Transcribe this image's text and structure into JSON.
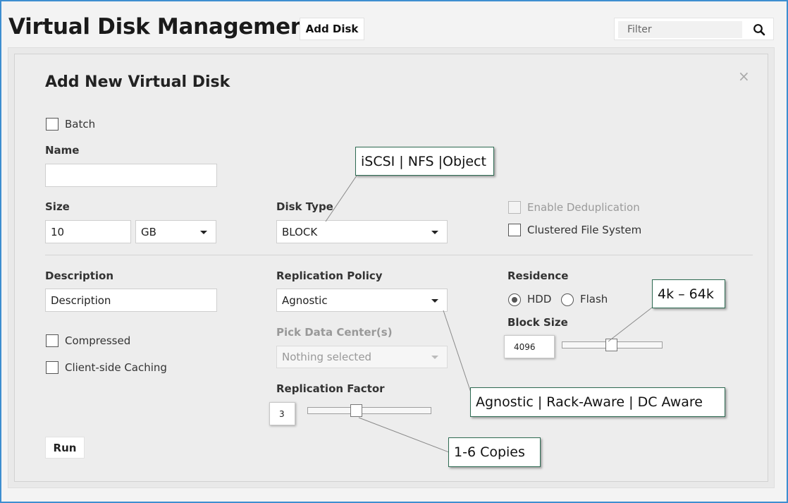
{
  "header": {
    "title": "Virtual Disk Management",
    "add_disk_label": "Add Disk",
    "filter_placeholder": "Filter",
    "search_icon": "search-icon"
  },
  "dialog": {
    "title": "Add New Virtual Disk",
    "close_label": "×",
    "batch": {
      "label": "Batch",
      "checked": false
    },
    "name": {
      "label": "Name",
      "value": ""
    },
    "size": {
      "label": "Size",
      "value": "10",
      "unit": "GB"
    },
    "disk_type": {
      "label": "Disk Type",
      "value": "BLOCK"
    },
    "enable_dedup": {
      "label": "Enable Deduplication",
      "checked": false,
      "disabled": true
    },
    "clustered_fs": {
      "label": "Clustered File System",
      "checked": false
    },
    "description": {
      "label": "Description",
      "value": "Description"
    },
    "compressed": {
      "label": "Compressed",
      "checked": false
    },
    "client_caching": {
      "label": "Client-side Caching",
      "checked": false
    },
    "replication_policy": {
      "label": "Replication Policy",
      "value": "Agnostic"
    },
    "pick_dc": {
      "label": "Pick Data Center(s)",
      "placeholder": "Nothing selected",
      "disabled": true
    },
    "replication_factor": {
      "label": "Replication Factor",
      "value": "3",
      "min": 1,
      "max": 6
    },
    "residence": {
      "label": "Residence",
      "options": [
        "HDD",
        "Flash"
      ],
      "selected": "HDD"
    },
    "block_size": {
      "label": "Block Size",
      "value": "4096"
    },
    "run_label": "Run"
  },
  "callouts": {
    "disk_type": "iSCSI | NFS |Object",
    "block_size": "4k – 64k",
    "replication_policy": "Agnostic | Rack-Aware | DC Aware",
    "replication_factor": "1-6 Copies"
  },
  "colors": {
    "frame_border": "#3e8ed0",
    "callout_border": "#2e6b52"
  }
}
